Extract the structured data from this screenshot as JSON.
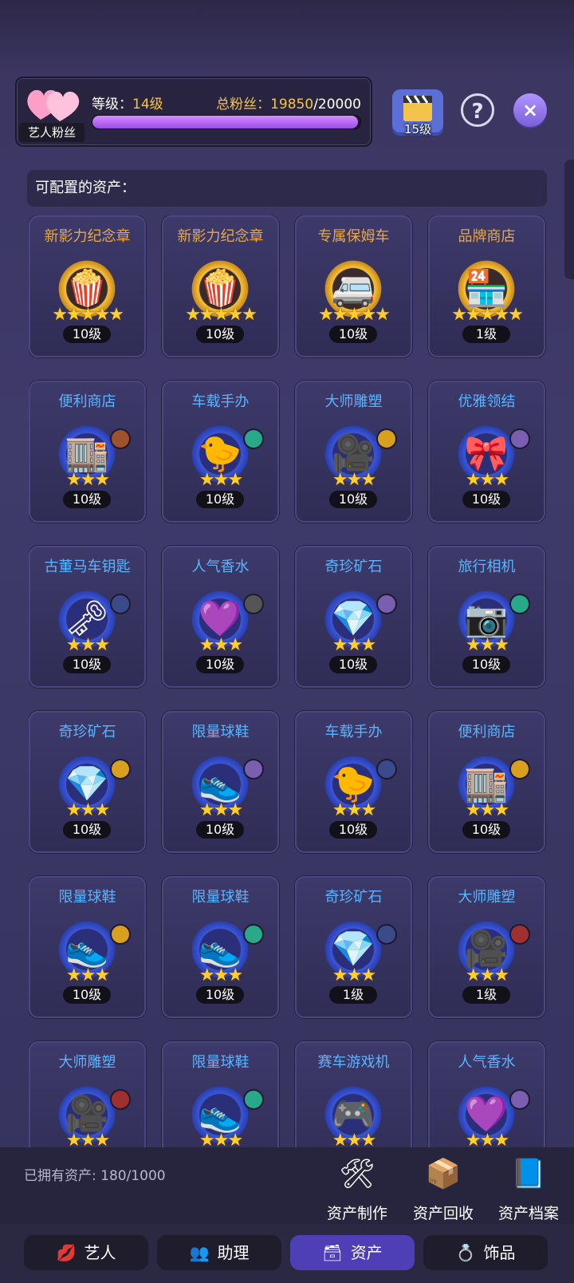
{
  "header": {
    "fan_tag": "艺人粉丝",
    "level_label": "等级：",
    "level_value": "14级",
    "fans_label": "总粉丝：",
    "fans_current": "19850",
    "fans_total": "/20000",
    "fans_progress": 0.9925,
    "clapper_level": "15级",
    "help_icon": "?",
    "close_icon": "×"
  },
  "section_title": "可配置的资产：",
  "assets": [
    {
      "name": "新影力纪念章",
      "level": "10级",
      "stars": "★★★★★",
      "icon": "🍿",
      "tier": "gold",
      "badge": ""
    },
    {
      "name": "新影力纪念章",
      "level": "10级",
      "stars": "★★★★★",
      "icon": "🍿",
      "tier": "gold",
      "badge": ""
    },
    {
      "name": "专属保姆车",
      "level": "10级",
      "stars": "★★★★★",
      "icon": "🚐",
      "tier": "gold",
      "badge": ""
    },
    {
      "name": "品牌商店",
      "level": "1级",
      "stars": "★★★★★",
      "icon": "🏪",
      "tier": "gold",
      "badge": ""
    },
    {
      "name": "便利商店",
      "level": "10级",
      "stars": "★★★",
      "icon": "🏬",
      "tier": "blue",
      "badge": "#a0522d"
    },
    {
      "name": "车载手办",
      "level": "10级",
      "stars": "★★★",
      "icon": "🐤",
      "tier": "blue",
      "badge": "#2aa88a"
    },
    {
      "name": "大师雕塑",
      "level": "10级",
      "stars": "★★★",
      "icon": "🎥",
      "tier": "blue",
      "badge": "#d9a020"
    },
    {
      "name": "优雅领结",
      "level": "10级",
      "stars": "★★★",
      "icon": "🎀",
      "tier": "blue",
      "badge": "#7a5fb0"
    },
    {
      "name": "古董马车钥匙",
      "level": "10级",
      "stars": "★★★",
      "icon": "🗝",
      "tier": "blue",
      "badge": "#3a4a8a"
    },
    {
      "name": "人气香水",
      "level": "10级",
      "stars": "★★★",
      "icon": "💜",
      "tier": "blue",
      "badge": "#555"
    },
    {
      "name": "奇珍矿石",
      "level": "10级",
      "stars": "★★★",
      "icon": "💎",
      "tier": "blue",
      "badge": "#7a5fb0"
    },
    {
      "name": "旅行相机",
      "level": "10级",
      "stars": "★★★",
      "icon": "📷",
      "tier": "blue",
      "badge": "#2aa88a"
    },
    {
      "name": "奇珍矿石",
      "level": "10级",
      "stars": "★★★",
      "icon": "💎",
      "tier": "blue",
      "badge": "#d9a020"
    },
    {
      "name": "限量球鞋",
      "level": "10级",
      "stars": "★★★",
      "icon": "👟",
      "tier": "blue",
      "badge": "#7a5fb0"
    },
    {
      "name": "车载手办",
      "level": "10级",
      "stars": "★★★",
      "icon": "🐤",
      "tier": "blue",
      "badge": "#3a4a8a"
    },
    {
      "name": "便利商店",
      "level": "10级",
      "stars": "★★★",
      "icon": "🏬",
      "tier": "blue",
      "badge": "#d9a020"
    },
    {
      "name": "限量球鞋",
      "level": "10级",
      "stars": "★★★",
      "icon": "👟",
      "tier": "blue",
      "badge": "#d9a020"
    },
    {
      "name": "限量球鞋",
      "level": "10级",
      "stars": "★★★",
      "icon": "👟",
      "tier": "blue",
      "badge": "#2aa88a"
    },
    {
      "name": "奇珍矿石",
      "level": "1级",
      "stars": "★★★",
      "icon": "💎",
      "tier": "blue",
      "badge": "#3a4a8a"
    },
    {
      "name": "大师雕塑",
      "level": "1级",
      "stars": "★★★",
      "icon": "🎥",
      "tier": "blue",
      "badge": "#a03030"
    },
    {
      "name": "大师雕塑",
      "level": "",
      "stars": "★★★",
      "icon": "🎥",
      "tier": "blue",
      "badge": "#a03030"
    },
    {
      "name": "限量球鞋",
      "level": "",
      "stars": "★★★",
      "icon": "👟",
      "tier": "blue",
      "badge": "#2aa88a"
    },
    {
      "name": "赛车游戏机",
      "level": "",
      "stars": "★★★",
      "icon": "🎮",
      "tier": "blue",
      "badge": ""
    },
    {
      "name": "人气香水",
      "level": "",
      "stars": "★★★",
      "icon": "💜",
      "tier": "blue",
      "badge": "#7a5fb0"
    }
  ],
  "bottom": {
    "owned_label": "已拥有资产: 180/1000",
    "tools": [
      {
        "label": "资产制作",
        "icon": "🛠"
      },
      {
        "label": "资产回收",
        "icon": "📦"
      },
      {
        "label": "资产档案",
        "icon": "📘"
      }
    ]
  },
  "tabs": [
    {
      "label": "艺人",
      "icon": "💋",
      "active": false
    },
    {
      "label": "助理",
      "icon": "👥",
      "active": false
    },
    {
      "label": "资产",
      "icon": "🗃",
      "active": true
    },
    {
      "label": "饰品",
      "icon": "💍",
      "active": false
    }
  ]
}
